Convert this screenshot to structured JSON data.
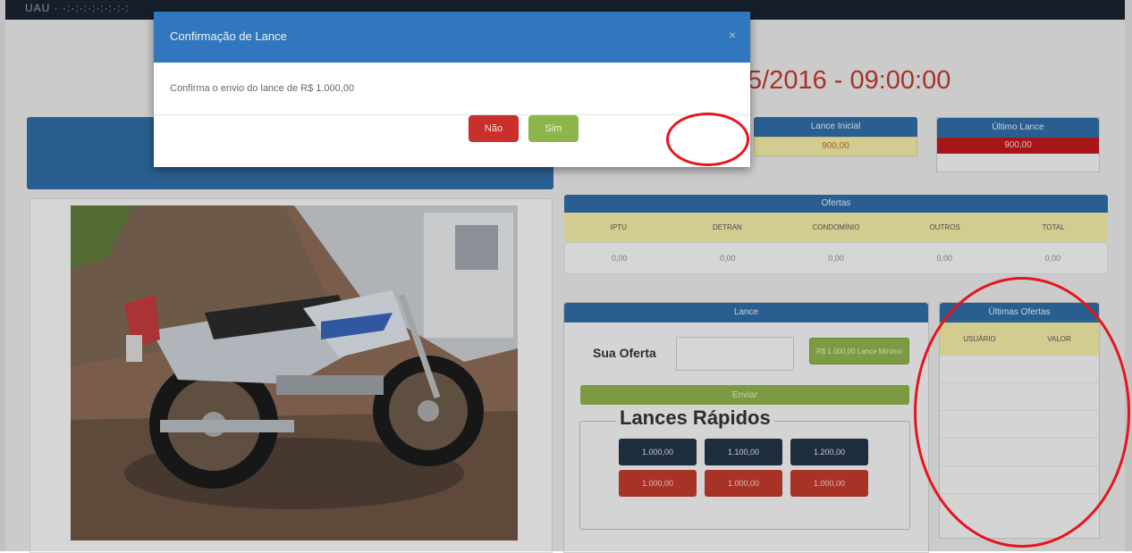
{
  "topbar": {
    "brand": "UAU · ·:·:·:·:·:·:·:·:"
  },
  "auction": {
    "date_time": "5/2016 - 09:00:00"
  },
  "stats": {
    "lance_inicial": {
      "label": "Lance Inicial",
      "value": "900,00"
    },
    "ultimo_lance": {
      "label": "Último Lance",
      "value": "900,00"
    }
  },
  "ofertas": {
    "title": "Ofertas",
    "columns": [
      "IPTU",
      "DETRAN",
      "CONDOMÍNIO",
      "OUTROS",
      "TOTAL"
    ],
    "values": [
      "0,00",
      "0,00",
      "0,00",
      "0,00",
      "0,00"
    ]
  },
  "lance": {
    "title": "Lance",
    "sua_oferta_label": "Sua Oferta",
    "small_button_label": "R$ 1.000,00 Lance Mínimo",
    "enviar_label": "Enviar",
    "rapidos_title": "Lances Rápidos",
    "quick_bids_dark": [
      "1.000,00",
      "1.100,00",
      "1.200,00"
    ],
    "quick_bids_red": [
      "1.000,00",
      "1.000,00",
      "1.000,00"
    ]
  },
  "ultimas": {
    "title": "Últimas Ofertas",
    "columns": [
      "USUÁRIO",
      "VALOR"
    ]
  },
  "modal": {
    "title": "Confirmação de Lance",
    "close_glyph": "×",
    "message": "Confirma o envio do lance de R$ 1.000,00",
    "no_label": "Não",
    "yes_label": "Sim"
  },
  "colors": {
    "primary_blue": "#2e6da4",
    "modal_blue": "#3177bd",
    "danger_red": "#c9302c",
    "success_green": "#8cb54a",
    "highlight_red": "#e8141c",
    "date_red": "#c0392b"
  }
}
